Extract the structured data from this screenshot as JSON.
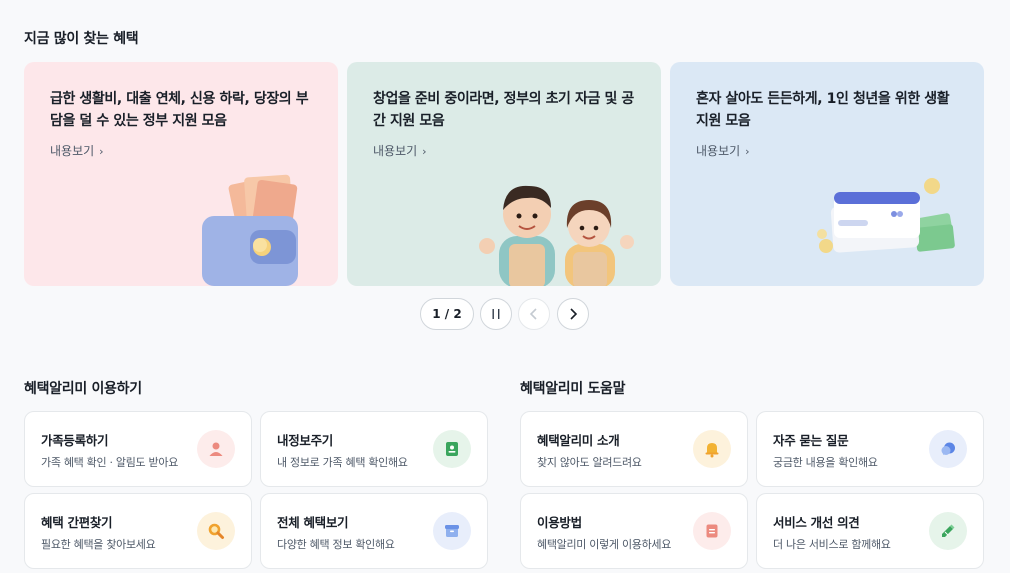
{
  "popular": {
    "title": "지금 많이 찾는 혜택",
    "cards": [
      {
        "title": "급한 생활비, 대출 연체, 신용 하락, 당장의 부담을 덜 수 있는 정부 지원 모음",
        "more": "내용보기",
        "bg": "#fde7ea"
      },
      {
        "title": "창업을 준비 중이라면, 정부의 초기 자금 및 공간 지원 모음",
        "more": "내용보기",
        "bg": "#dcebe7"
      },
      {
        "title": "혼자 살아도 든든하게, 1인 청년을 위한 생활지원 모음",
        "more": "내용보기",
        "bg": "#dbe8f5"
      }
    ]
  },
  "pager": {
    "count": "1 / 2"
  },
  "usage": {
    "title": "혜택알리미 이용하기",
    "tiles": [
      {
        "title": "가족등록하기",
        "desc": "가족 혜택 확인 · 알림도 받아요",
        "icon": "person-icon",
        "color": "#fdeceb"
      },
      {
        "title": "내정보주기",
        "desc": "내 정보로 가족 혜택 확인해요",
        "icon": "document-icon",
        "color": "#e6f4ea"
      },
      {
        "title": "혜택 간편찾기",
        "desc": "필요한 혜택을 찾아보세요",
        "icon": "magnifier-icon",
        "color": "#fdf2dc"
      },
      {
        "title": "전체 혜택보기",
        "desc": "다양한 혜택 정보 확인해요",
        "icon": "box-icon",
        "color": "#e8eefb"
      }
    ]
  },
  "help": {
    "title": "혜택알리미 도움말",
    "tiles": [
      {
        "title": "혜택알리미 소개",
        "desc": "찾지 않아도 알려드려요",
        "icon": "bell-icon",
        "color": "#fdf2dc"
      },
      {
        "title": "자주 묻는 질문",
        "desc": "궁금한 내용을 확인해요",
        "icon": "chat-bubble-icon",
        "color": "#e8eefb"
      },
      {
        "title": "이용방법",
        "desc": "혜택알리미 이렇게 이용하세요",
        "icon": "note-icon",
        "color": "#fdeceb"
      },
      {
        "title": "서비스 개선 의견",
        "desc": "더 나은 서비스로 함께해요",
        "icon": "pencil-icon",
        "color": "#e6f4ea"
      }
    ]
  }
}
